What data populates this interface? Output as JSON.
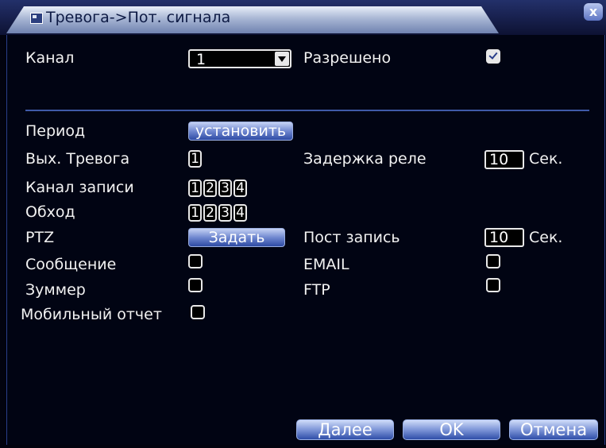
{
  "dialog": {
    "title": "Тревога->Пот. сигнала",
    "close_glyph": "x"
  },
  "form": {
    "channel_label": "Канал",
    "channel_value": "1",
    "enabled_label": "Разрешено",
    "enabled_checked": true,
    "period_label": "Период",
    "period_button": "установить",
    "alarm_out_label": "Вых. Тревога",
    "alarm_out_boxes": [
      "1"
    ],
    "relay_delay_label": "Задержка реле",
    "relay_delay_value": "10",
    "relay_delay_unit": "Сек.",
    "record_channel_label": "Канал записи",
    "record_channel_boxes": [
      "1",
      "2",
      "3",
      "4"
    ],
    "tour_label": "Обход",
    "tour_boxes": [
      "1",
      "2",
      "3",
      "4"
    ],
    "ptz_label": "PTZ",
    "ptz_button": "Задать",
    "post_record_label": "Пост запись",
    "post_record_value": "10",
    "post_record_unit": "Сек.",
    "message_label": "Сообщение",
    "email_label": "EMAIL",
    "buzzer_label": "Зуммер",
    "ftp_label": "FTP",
    "mobile_report_label": "Мобильный отчет"
  },
  "footer": {
    "next_button": "Далее",
    "ok_button": "OK",
    "cancel_button": "Отмена"
  }
}
